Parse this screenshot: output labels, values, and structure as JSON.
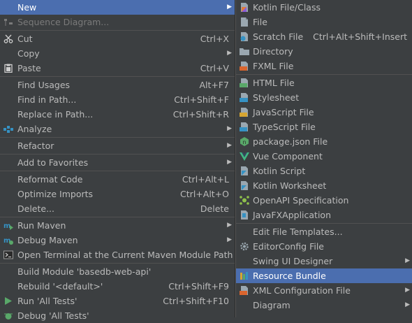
{
  "left_menu": {
    "new": "New",
    "sequence_diagram": "Sequence Diagram...",
    "cut": "Cut",
    "cut_sc": "Ctrl+X",
    "copy": "Copy",
    "paste": "Paste",
    "paste_sc": "Ctrl+V",
    "find_usages": "Find Usages",
    "find_usages_sc": "Alt+F7",
    "find_in_path": "Find in Path...",
    "find_in_path_sc": "Ctrl+Shift+F",
    "replace_in_path": "Replace in Path...",
    "replace_in_path_sc": "Ctrl+Shift+R",
    "analyze": "Analyze",
    "refactor": "Refactor",
    "add_to_favorites": "Add to Favorites",
    "reformat_code": "Reformat Code",
    "reformat_code_sc": "Ctrl+Alt+L",
    "optimize_imports": "Optimize Imports",
    "optimize_imports_sc": "Ctrl+Alt+O",
    "delete": "Delete...",
    "delete_sc": "Delete",
    "run_maven": "Run Maven",
    "debug_maven": "Debug Maven",
    "open_terminal": "Open Terminal at the Current Maven Module Path",
    "build_module": "Build Module 'basedb-web-api'",
    "rebuild": "Rebuild '<default>'",
    "rebuild_sc": "Ctrl+Shift+F9",
    "run_all_tests": "Run 'All Tests'",
    "run_all_tests_sc": "Ctrl+Shift+F10",
    "debug_all_tests": "Debug 'All Tests'"
  },
  "right_menu": {
    "kotlin_file_class": "Kotlin File/Class",
    "file": "File",
    "scratch_file": "Scratch File",
    "scratch_file_sc": "Ctrl+Alt+Shift+Insert",
    "directory": "Directory",
    "fxml_file": "FXML File",
    "html_file": "HTML File",
    "stylesheet": "Stylesheet",
    "javascript_file": "JavaScript File",
    "typescript_file": "TypeScript File",
    "package_json": "package.json File",
    "vue_component": "Vue Component",
    "kotlin_script": "Kotlin Script",
    "kotlin_worksheet": "Kotlin Worksheet",
    "openapi_spec": "OpenAPI Specification",
    "javafx_app": "JavaFXApplication",
    "edit_file_templates": "Edit File Templates...",
    "editorconfig_file": "EditorConfig File",
    "swing_ui_designer": "Swing UI Designer",
    "resource_bundle": "Resource Bundle",
    "xml_configuration_file": "XML Configuration File",
    "diagram": "Diagram"
  },
  "colors": {
    "background": "#3c3f41",
    "selection": "#4b6eaf",
    "text": "#bbbbbb"
  },
  "icons": {
    "css_badge": "CSS",
    "js_badge": "JS",
    "ts_badge": "TS",
    "html_badge": "H",
    "fxml_badge": "<>",
    "arrow": "▶"
  }
}
